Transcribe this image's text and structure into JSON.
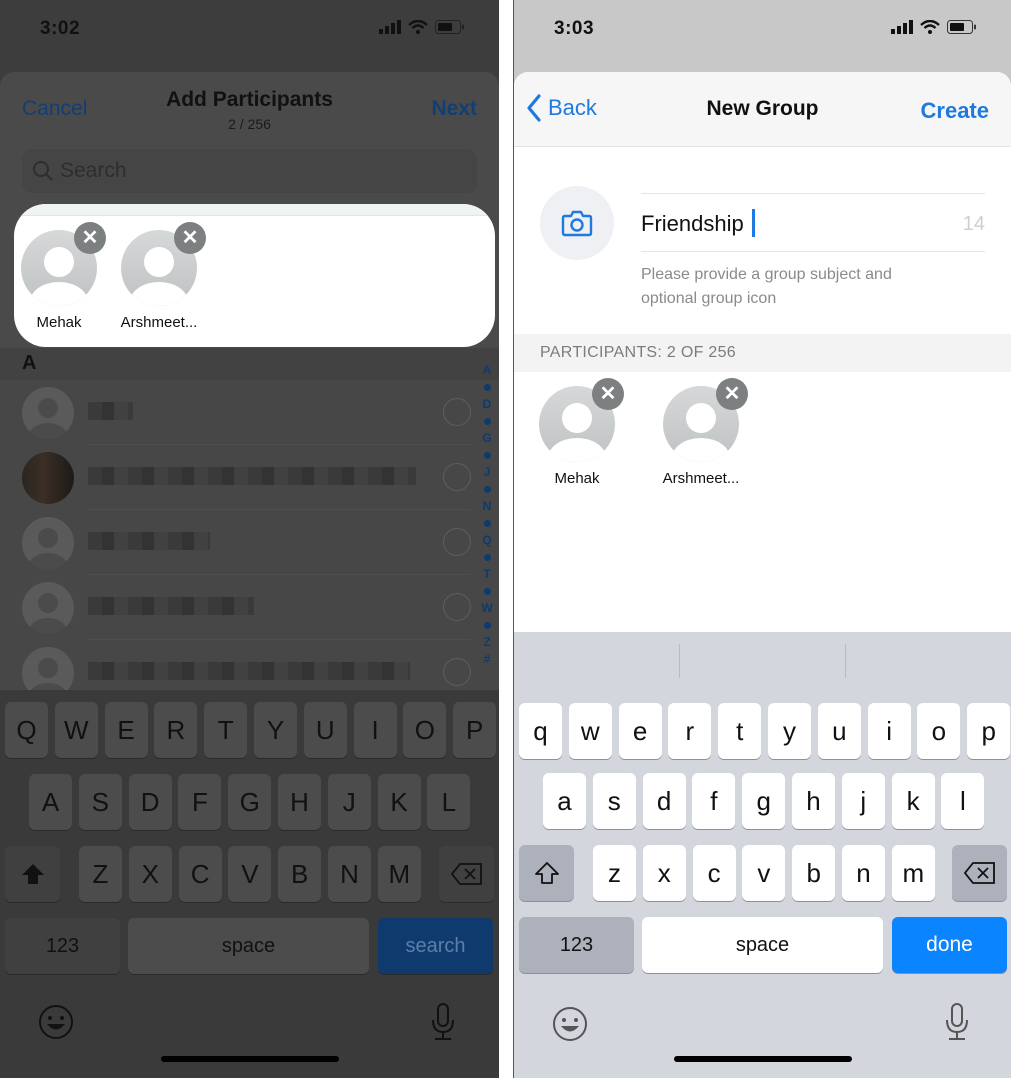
{
  "left_screen": {
    "status": {
      "time": "3:02"
    },
    "nav": {
      "cancel_label": "Cancel",
      "title": "Add Participants",
      "subtitle": "2 / 256",
      "next_label": "Next"
    },
    "search": {
      "placeholder": "Search"
    },
    "selected": [
      {
        "name": "Mehak"
      },
      {
        "name": "Arshmeet..."
      }
    ],
    "section_header": "A",
    "index_letters": [
      "A",
      "D",
      "G",
      "J",
      "N",
      "Q",
      "T",
      "W",
      "Z",
      "#"
    ],
    "contacts_count_visible": 5,
    "keyboard": {
      "row1": [
        "Q",
        "W",
        "E",
        "R",
        "T",
        "Y",
        "U",
        "I",
        "O",
        "P"
      ],
      "row2": [
        "A",
        "S",
        "D",
        "F",
        "G",
        "H",
        "J",
        "K",
        "L"
      ],
      "row3": [
        "Z",
        "X",
        "C",
        "V",
        "B",
        "N",
        "M"
      ],
      "numbers_label": "123",
      "space_label": "space",
      "action_label": "search"
    }
  },
  "right_screen": {
    "status": {
      "time": "3:03"
    },
    "nav": {
      "back_label": "Back",
      "title": "New Group",
      "create_label": "Create"
    },
    "subject": {
      "value": "Friendship",
      "remaining_chars": "14",
      "hint": "Please provide a group subject and optional group icon"
    },
    "participants_header": "PARTICIPANTS: 2 OF 256",
    "participants": [
      {
        "name": "Mehak"
      },
      {
        "name": "Arshmeet..."
      }
    ],
    "keyboard": {
      "row1": [
        "q",
        "w",
        "e",
        "r",
        "t",
        "y",
        "u",
        "i",
        "o",
        "p"
      ],
      "row2": [
        "a",
        "s",
        "d",
        "f",
        "g",
        "h",
        "j",
        "k",
        "l"
      ],
      "row3": [
        "z",
        "x",
        "c",
        "v",
        "b",
        "n",
        "m"
      ],
      "numbers_label": "123",
      "space_label": "space",
      "action_label": "done"
    }
  },
  "colors": {
    "accent_blue": "#1f7ae0",
    "done_key_blue": "#0a84ff",
    "remove_badge": "#7d8081"
  }
}
